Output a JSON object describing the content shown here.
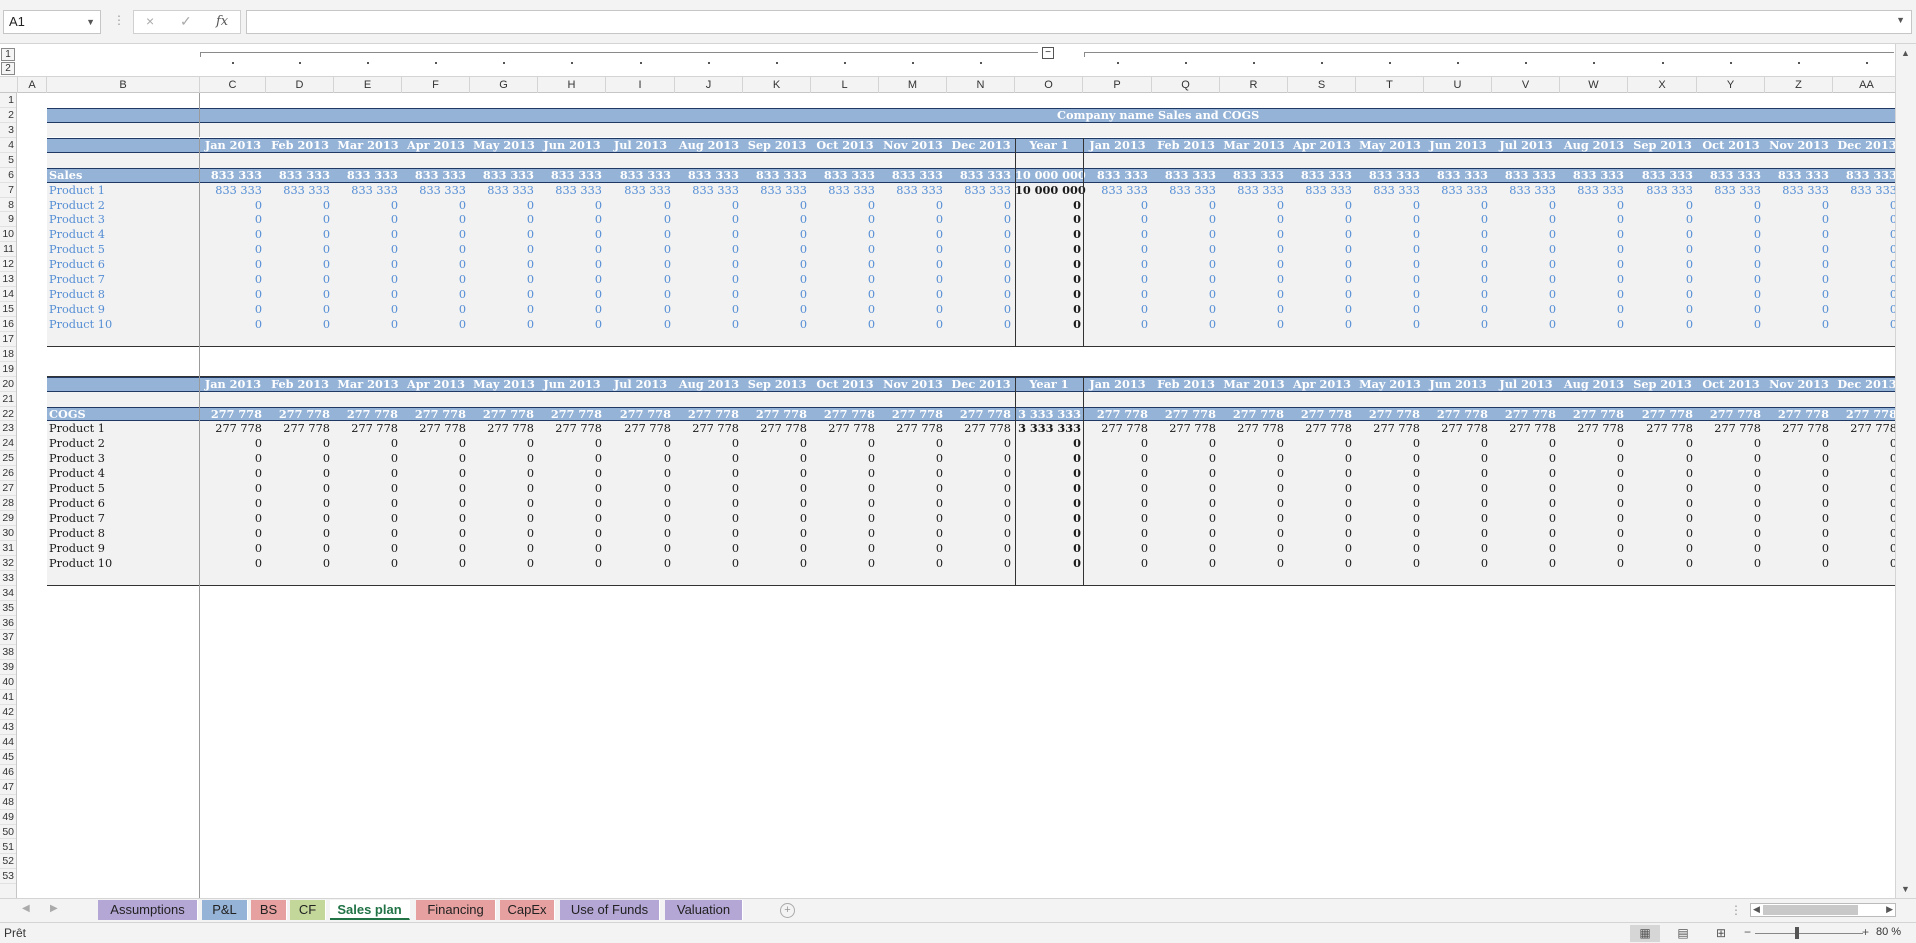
{
  "formula_bar": {
    "name_box": "A1",
    "cancel_icon": "×",
    "enter_icon": "✓",
    "fx_label": "fx",
    "formula": ""
  },
  "outline_levels": [
    "1",
    "2"
  ],
  "columns": [
    "A",
    "B",
    "C",
    "D",
    "E",
    "F",
    "G",
    "H",
    "I",
    "J",
    "K",
    "L",
    "M",
    "N",
    "O",
    "P",
    "Q",
    "R",
    "S",
    "T",
    "U",
    "V",
    "W",
    "X",
    "Y",
    "Z",
    "AA"
  ],
  "rows": [
    "1",
    "2",
    "3",
    "4",
    "5",
    "6",
    "7",
    "8",
    "9",
    "10",
    "11",
    "12",
    "13",
    "14",
    "15",
    "16",
    "17",
    "18",
    "19",
    "20",
    "21",
    "22",
    "23",
    "24",
    "25",
    "26",
    "27",
    "28",
    "29",
    "30",
    "31",
    "32",
    "33",
    "34",
    "35",
    "36",
    "37",
    "38",
    "39",
    "40",
    "41",
    "42",
    "43",
    "44",
    "45",
    "46",
    "47",
    "48",
    "49",
    "50",
    "51",
    "52",
    "53"
  ],
  "sheet": {
    "title": "Company name Sales and COGS",
    "months": [
      "Jan 2013",
      "Feb 2013",
      "Mar 2013",
      "Apr 2013",
      "May 2013",
      "Jun 2013",
      "Jul 2013",
      "Aug 2013",
      "Sep 2013",
      "Oct 2013",
      "Nov 2013",
      "Dec 2013"
    ],
    "year_label": "Year 1",
    "sales": {
      "label": "Sales",
      "total_monthly": "833 333",
      "total_year": "10 000 000",
      "products": [
        {
          "name": "Product 1",
          "monthly": "833 333",
          "year": "10 000 000"
        },
        {
          "name": "Product 2",
          "monthly": "0",
          "year": "0"
        },
        {
          "name": "Product 3",
          "monthly": "0",
          "year": "0"
        },
        {
          "name": "Product 4",
          "monthly": "0",
          "year": "0"
        },
        {
          "name": "Product 5",
          "monthly": "0",
          "year": "0"
        },
        {
          "name": "Product 6",
          "monthly": "0",
          "year": "0"
        },
        {
          "name": "Product 7",
          "monthly": "0",
          "year": "0"
        },
        {
          "name": "Product 8",
          "monthly": "0",
          "year": "0"
        },
        {
          "name": "Product 9",
          "monthly": "0",
          "year": "0"
        },
        {
          "name": "Product 10",
          "monthly": "0",
          "year": "0"
        }
      ]
    },
    "cogs": {
      "label": "COGS",
      "total_monthly": "277 778",
      "total_year": "3 333 333",
      "products": [
        {
          "name": "Product 1",
          "monthly": "277 778",
          "year": "3 333 333"
        },
        {
          "name": "Product 2",
          "monthly": "0",
          "year": "0"
        },
        {
          "name": "Product 3",
          "monthly": "0",
          "year": "0"
        },
        {
          "name": "Product 4",
          "monthly": "0",
          "year": "0"
        },
        {
          "name": "Product 5",
          "monthly": "0",
          "year": "0"
        },
        {
          "name": "Product 6",
          "monthly": "0",
          "year": "0"
        },
        {
          "name": "Product 7",
          "monthly": "0",
          "year": "0"
        },
        {
          "name": "Product 8",
          "monthly": "0",
          "year": "0"
        },
        {
          "name": "Product 9",
          "monthly": "0",
          "year": "0"
        },
        {
          "name": "Product 10",
          "monthly": "0",
          "year": "0"
        }
      ]
    }
  },
  "tabs": [
    {
      "label": "Assumptions",
      "color": "#b4a7d6"
    },
    {
      "label": "P&L",
      "color": "#95b3d7"
    },
    {
      "label": "BS",
      "color": "#e6a0a0"
    },
    {
      "label": "CF",
      "color": "#c4d79b"
    },
    {
      "label": "Sales plan",
      "color": "#ffffff"
    },
    {
      "label": "Financing",
      "color": "#e6a0a0"
    },
    {
      "label": "CapEx",
      "color": "#e6a0a0"
    },
    {
      "label": "Use of Funds",
      "color": "#b4a7d6"
    },
    {
      "label": "Valuation",
      "color": "#b4a7d6"
    }
  ],
  "active_tab": "Sales plan",
  "status": {
    "text": "Prêt",
    "zoom": "80 %"
  }
}
